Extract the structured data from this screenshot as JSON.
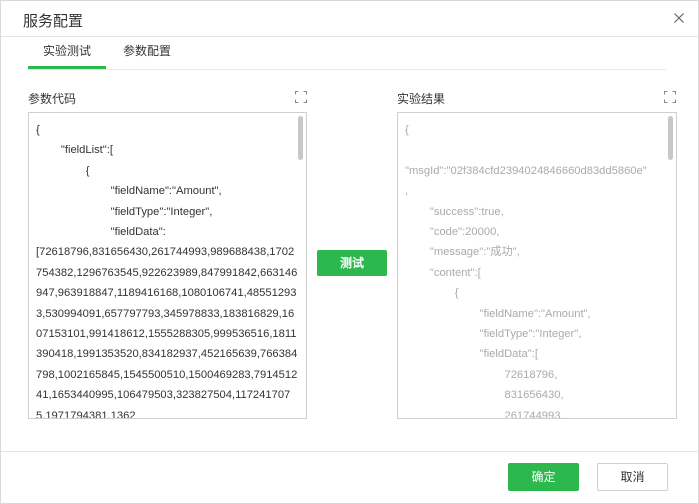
{
  "dialog": {
    "title": "服务配置",
    "close_icon": "close-icon"
  },
  "tabs": [
    {
      "label": "实验测试",
      "active": true
    },
    {
      "label": "参数配置",
      "active": false
    }
  ],
  "params": {
    "label": "参数代码",
    "expand_icon": "fullscreen-icon",
    "code": "{\n        \"fieldList\":[\n                {\n                        \"fieldName\":\"Amount\",\n                        \"fieldType\":\"Integer\",\n                        \"fieldData\":\n[72618796,831656430,261744993,989688438,1702754382,1296763545,922623989,847991842,663146947,963918847,1189416168,1080106741,485512933,530994091,657797793,345978833,183816829,1607153101,991418612,1555288305,999536516,1811390418,1991353520,834182937,452165639,766384798,1002165845,1545500510,1500469283,791451241,1653440995,106479503,323827504,1172417075,1971794381,1362"
  },
  "result": {
    "label": "实验结果",
    "expand_icon": "fullscreen-icon",
    "code": "{\n\n\"msgId\":\"02f384cfd2394024846660d83dd5860e\"\n,\n        \"success\":true,\n        \"code\":20000,\n        \"message\":\"成功\",\n        \"content\":[\n                {\n                        \"fieldName\":\"Amount\",\n                        \"fieldType\":\"Integer\",\n                        \"fieldData\":[\n                                72618796,\n                                831656430,\n                                261744993,"
  },
  "buttons": {
    "test": "测试",
    "ok": "确定",
    "cancel": "取消"
  },
  "colors": {
    "accent": "#2db84d",
    "border": "#cfcfcf"
  }
}
